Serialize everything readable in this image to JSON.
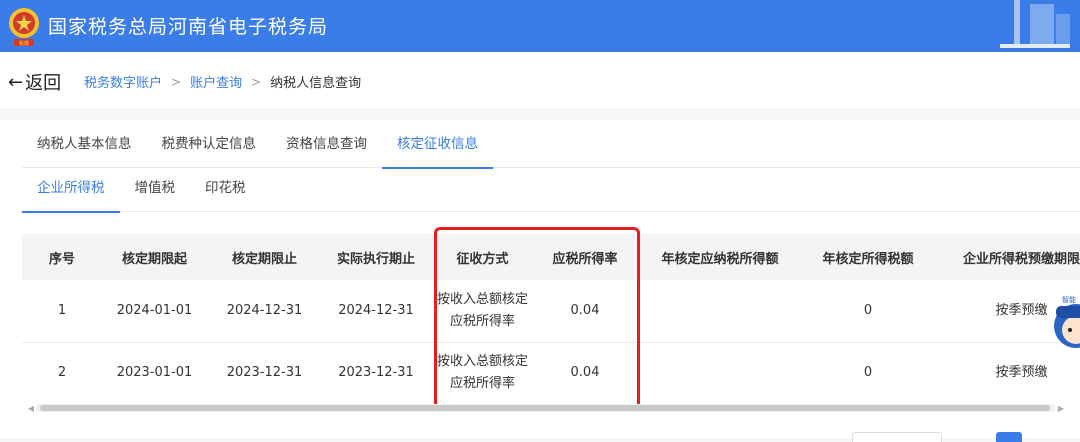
{
  "header": {
    "title": "国家税务总局河南省电子税务局",
    "emblem_text": "税徽",
    "bg_color": "#3a7de8"
  },
  "nav": {
    "back_label": "返回",
    "breadcrumb": [
      "税务数字账户",
      "账户查询",
      "纳税人信息查询"
    ]
  },
  "tabs": [
    "纳税人基本信息",
    "税费种认定信息",
    "资格信息查询",
    "核定征收信息"
  ],
  "active_tab": 3,
  "subtabs": [
    "企业所得税",
    "增值税",
    "印花税"
  ],
  "active_subtab": 0,
  "table": {
    "columns": [
      "序号",
      "核定期限起",
      "核定期限止",
      "实际执行期止",
      "征收方式",
      "应税所得率",
      "年核定应纳税所得额",
      "年核定所得税额",
      "企业所得税预缴期限"
    ],
    "rows": [
      [
        "1",
        "2024-01-01",
        "2024-12-31",
        "2024-12-31",
        "按收入总额核定应税所得率",
        "0.04",
        "",
        "0",
        "按季预缴"
      ],
      [
        "2",
        "2023-01-01",
        "2023-12-31",
        "2023-12-31",
        "按收入总额核定应税所得率",
        "0.04",
        "",
        "0",
        "按季预缴"
      ]
    ]
  },
  "highlight_color": "#e41f1f",
  "mascot_label": "智能"
}
